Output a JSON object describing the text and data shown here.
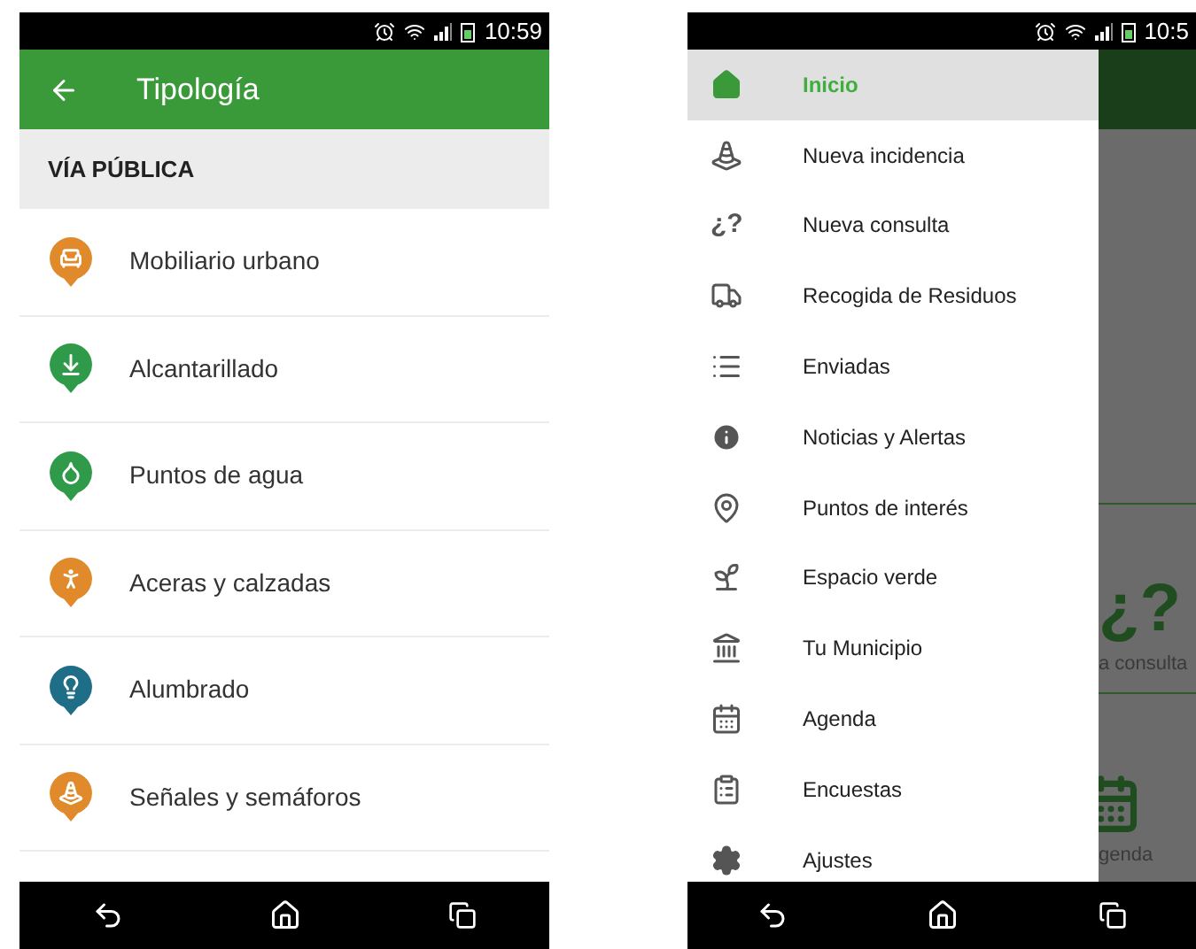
{
  "left": {
    "status_bar": {
      "time": "10:59"
    },
    "header": {
      "title": "Tipología"
    },
    "section": "VÍA PÚBLICA",
    "items": [
      {
        "label": "Mobiliario urbano",
        "color": "#e08a2c"
      },
      {
        "label": "Alcantarillado",
        "color": "#2e9a4a"
      },
      {
        "label": "Puntos de agua",
        "color": "#2e9a4a"
      },
      {
        "label": "Aceras y calzadas",
        "color": "#e08a2c"
      },
      {
        "label": "Alumbrado",
        "color": "#1d6e86"
      },
      {
        "label": "Señales y semáforos",
        "color": "#e08a2c"
      }
    ]
  },
  "right": {
    "status_bar": {
      "time": "10:5"
    },
    "drawer": {
      "items": [
        {
          "label": "Inicio",
          "selected": true
        },
        {
          "label": "Nueva incidencia",
          "selected": false
        },
        {
          "label": "Nueva consulta",
          "selected": false,
          "glyph": "¿?"
        },
        {
          "label": "Recogida de Residuos",
          "selected": false
        },
        {
          "label": "Enviadas",
          "selected": false
        },
        {
          "label": "Noticias y Alertas",
          "selected": false
        },
        {
          "label": "Puntos de interés",
          "selected": false
        },
        {
          "label": "Espacio verde",
          "selected": false
        },
        {
          "label": "Tu Municipio",
          "selected": false
        },
        {
          "label": "Agenda",
          "selected": false
        },
        {
          "label": "Encuestas",
          "selected": false
        },
        {
          "label": "Ajustes",
          "selected": false
        }
      ]
    },
    "background": {
      "tiles": [
        {
          "kind": "glyph",
          "glyph": "¿?",
          "label": "a consulta"
        },
        {
          "kind": "calendar",
          "label": "genda"
        }
      ]
    }
  }
}
